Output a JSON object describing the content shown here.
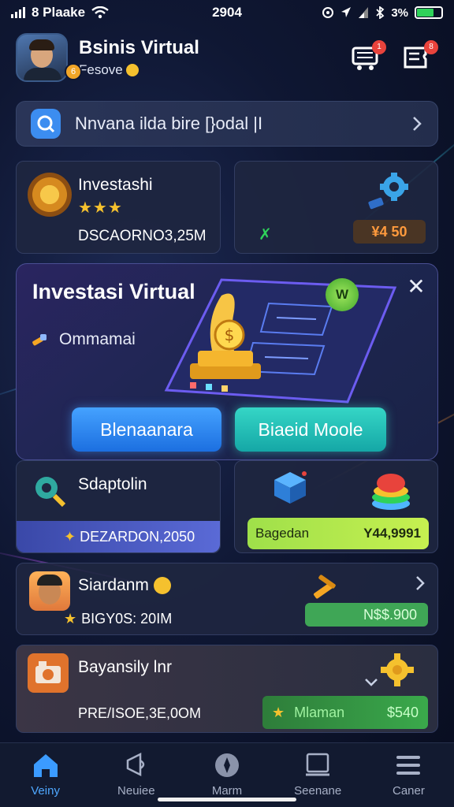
{
  "status_bar": {
    "carrier": "8 Plaake",
    "time": "2904",
    "battery_text": "3%"
  },
  "header": {
    "title": "Bsinis Virtual",
    "subtitle": "Fesove",
    "avatar_badge": "6",
    "cart_badge": "1",
    "menu_badge": "8"
  },
  "search": {
    "text": "Nnvana ilda bire [}odal |I"
  },
  "cards": {
    "top_left": {
      "title": "Investashi",
      "stars": "★★★",
      "value": "DSCAORNO3,25M"
    },
    "top_right": {
      "x_label": "✗",
      "pill": "¥4 50"
    }
  },
  "modal": {
    "title": "Investasi  Virtual",
    "line": "Ommamai",
    "badge": "W",
    "primary_button": "Blenaanara",
    "secondary_button": "Biaeid Moole"
  },
  "cards2": {
    "left": {
      "title": "Sdaptolin",
      "bar_text": "DEZARDON,2050"
    },
    "right": {
      "bar_left": "Bagedan",
      "bar_right": "Y44,9991"
    }
  },
  "rows": {
    "row1": {
      "title": "Siardanm",
      "sub": "BIGY0S: 20IM",
      "pill": "N$$.900"
    },
    "row2": {
      "title": "Bayansily lnr",
      "sub": "PRE/ISOE,3E,0OM",
      "pill_left": "Mlaman",
      "pill_right": "$540"
    }
  },
  "nav": [
    {
      "label": "Veiny"
    },
    {
      "label": "Neuiee"
    },
    {
      "label": "Marm"
    },
    {
      "label": "Seenane"
    },
    {
      "label": "Caner"
    }
  ],
  "colors": {
    "accent_blue": "#3c8df0",
    "accent_green": "#2fd25a",
    "accent_orange": "#ff9a3d",
    "gold": "#f5c12e"
  },
  "battery_level": 0.7
}
